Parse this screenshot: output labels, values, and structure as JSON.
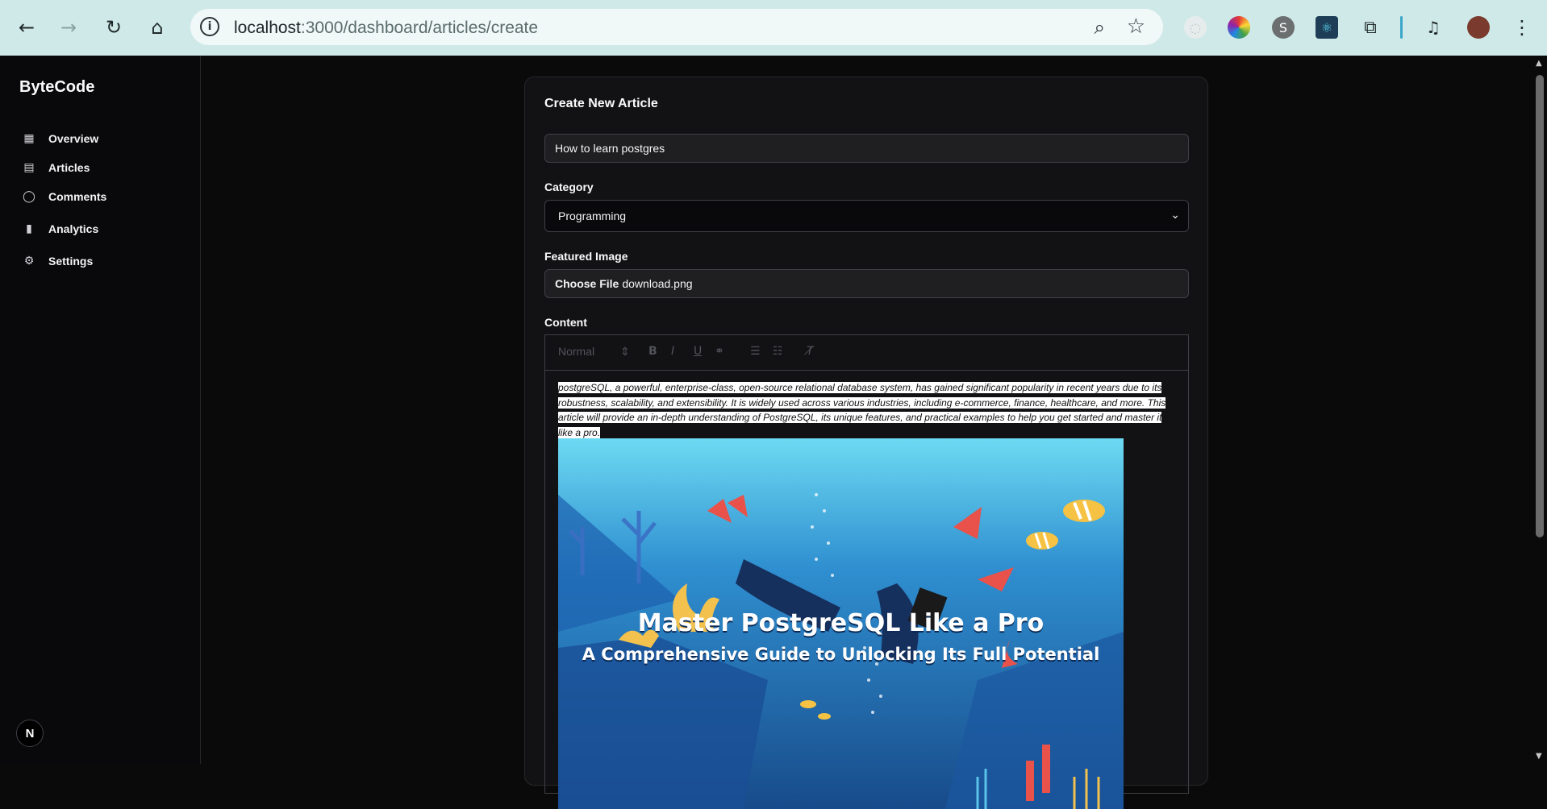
{
  "browser": {
    "url_host": "localhost",
    "url_path": ":3000/dashboard/articles/create",
    "back_icon": "←",
    "forward_icon": "→",
    "reload_icon": "↻",
    "home_icon": "⌂",
    "info_icon": "i",
    "zoom_icon": "⌕",
    "star_icon": "☆",
    "menu_icon": "⋮"
  },
  "sidebar": {
    "brand": "ByteCode",
    "items": [
      {
        "label": "Overview",
        "icon": "▦"
      },
      {
        "label": "Articles",
        "icon": "▤"
      },
      {
        "label": "Comments",
        "icon": "◯"
      },
      {
        "label": "Analytics",
        "icon": "▮"
      },
      {
        "label": "Settings",
        "icon": "⚙"
      }
    ],
    "badge": "N"
  },
  "form": {
    "title": "Create New Article",
    "title_value": "How to learn postgres",
    "category_label": "Category",
    "category_value": "Programming",
    "image_label": "Featured Image",
    "file_button": "Choose File",
    "file_name": "download.png",
    "content_label": "Content"
  },
  "editor": {
    "format_select": "Normal",
    "text": "postgreSQL, a powerful, enterprise-class, open-source relational database system, has gained significant popularity in recent years due to its robustness, scalability, and extensibility. It is widely used across various industries, including e-commerce, finance, healthcare, and more. This article will provide an in-depth understanding of PostgreSQL, its unique features, and practical examples to help you get started and master it like a pro.",
    "image_title": "Master PostgreSQL Like a Pro",
    "image_subtitle": "A Comprehensive Guide to Unlocking Its Full Potential"
  },
  "colors": {
    "chrome_bg": "#cfe9e8",
    "app_bg": "#0a0a0b",
    "card_bg": "#121214",
    "ocean_top": "#5fd3ef",
    "ocean_bottom": "#1a4b8c"
  }
}
